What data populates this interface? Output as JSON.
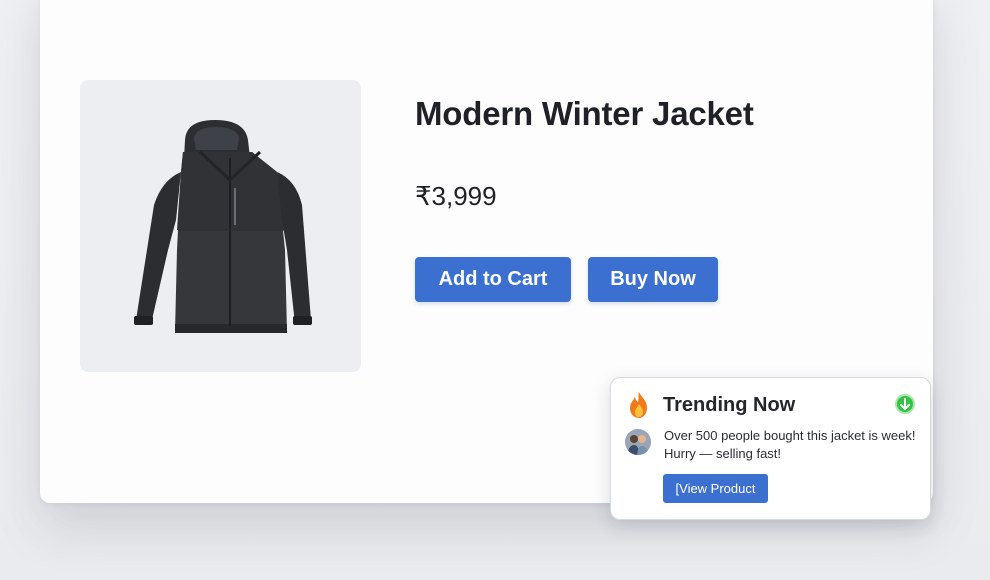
{
  "product": {
    "title": "Modern Winter Jacket",
    "price": "₹3,999",
    "image_alt_icon": "jacket-image"
  },
  "actions": {
    "add_to_cart_label": "Add to Cart",
    "buy_now_label": "Buy Now"
  },
  "notification": {
    "icon": "fire-icon",
    "title": "Trending Now",
    "dismiss_icon": "green-circle-icon",
    "avatar_icon": "user-avatar",
    "message_line1": "Over 500 people bought this jacket is week!",
    "message_line2": "Hurry — selling fast!",
    "link_label": "[View Product"
  },
  "colors": {
    "accent": "#3b6fd0",
    "card_background": "#fdfdfd",
    "image_background": "#edeef1",
    "status_green": "#2fbf3f"
  }
}
